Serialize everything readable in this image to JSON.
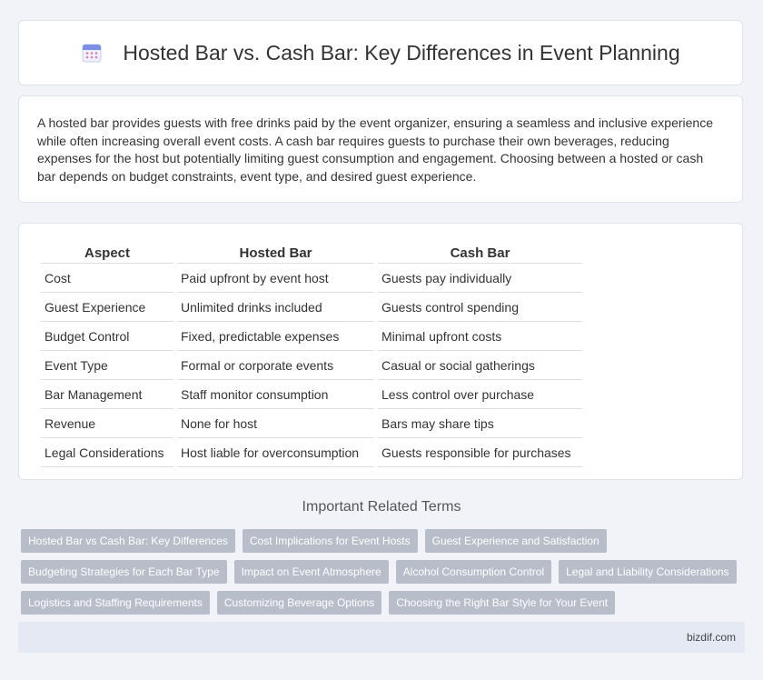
{
  "header": {
    "title": "Hosted Bar vs. Cash Bar: Key Differences in Event Planning",
    "icon": "calendar-icon"
  },
  "intro": "A hosted bar provides guests with free drinks paid by the event organizer, ensuring a seamless and inclusive experience while often increasing overall event costs. A cash bar requires guests to purchase their own beverages, reducing expenses for the host but potentially limiting guest consumption and engagement. Choosing between a hosted or cash bar depends on budget constraints, event type, and desired guest experience.",
  "table": {
    "headers": [
      "Aspect",
      "Hosted Bar",
      "Cash Bar"
    ],
    "rows": [
      [
        "Cost",
        "Paid upfront by event host",
        "Guests pay individually"
      ],
      [
        "Guest Experience",
        "Unlimited drinks included",
        "Guests control spending"
      ],
      [
        "Budget Control",
        "Fixed, predictable expenses",
        "Minimal upfront costs"
      ],
      [
        "Event Type",
        "Formal or corporate events",
        "Casual or social gatherings"
      ],
      [
        "Bar Management",
        "Staff monitor consumption",
        "Less control over purchase"
      ],
      [
        "Revenue",
        "None for host",
        "Bars may share tips"
      ],
      [
        "Legal Considerations",
        "Host liable for overconsumption",
        "Guests responsible for purchases"
      ]
    ]
  },
  "related": {
    "title": "Important Related Terms",
    "rows": [
      [
        "Hosted Bar vs Cash Bar: Key Differences",
        "Cost Implications for Event Hosts",
        "Guest Experience and Satisfaction"
      ],
      [
        "Budgeting Strategies for Each Bar Type",
        "Impact on Event Atmosphere",
        "Alcohol Consumption Control",
        "Legal and Liability Considerations"
      ],
      [
        "Logistics and Staffing Requirements",
        "Customizing Beverage Options",
        "Choosing the Right Bar Style for Your Event"
      ]
    ]
  },
  "footer": {
    "brand": "bizdif.com"
  }
}
